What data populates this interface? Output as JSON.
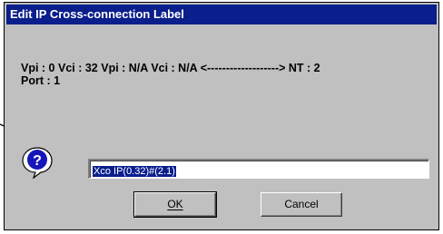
{
  "dialog": {
    "title": "Edit IP Cross-connection Label",
    "info_line1": "Vpi : 0 Vci : 32 Vpi : N/A Vci : N/A <-------------------> NT : 2",
    "info_line2": "Port : 1",
    "icon": "question-icon",
    "label_value": "Xco IP(0.32)#(2.1)",
    "ok_label": "OK",
    "cancel_label": "Cancel"
  },
  "colors": {
    "titlebar": "#0a1e8c",
    "face": "#c0c0c0",
    "selection": "#0a1e8c"
  }
}
